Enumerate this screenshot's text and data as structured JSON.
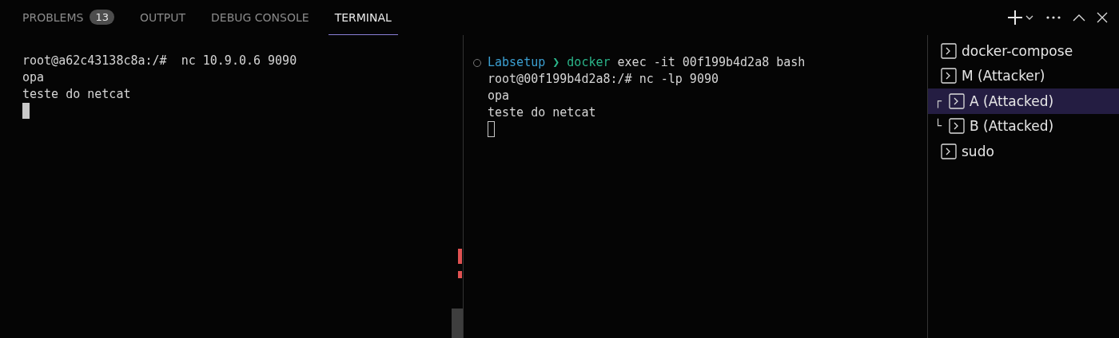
{
  "tabs": [
    {
      "label": "PROBLEMS",
      "badge": "13",
      "selected": false
    },
    {
      "label": "OUTPUT",
      "selected": false
    },
    {
      "label": "DEBUG CONSOLE",
      "selected": false
    },
    {
      "label": "TERMINAL",
      "selected": true
    }
  ],
  "terminals": [
    {
      "lines": [
        "root@a62c43138c8a:/#  nc 10.9.0.6 9090",
        "opa",
        "teste do netcat"
      ],
      "cursor_focused": true
    },
    {
      "prompt": [
        {
          "text": "Labsetup",
          "color": "#3b9fd1"
        },
        {
          "text": " ❯ ",
          "color": "#2bb58a"
        },
        {
          "text": "docker",
          "color": "#2bb58a"
        },
        {
          "text": " exec -it 00f199b4d2a8 bash",
          "color": "#d4d4d4"
        }
      ],
      "lines": [
        "root@00f199b4d2a8:/# nc -lp 9090",
        "opa",
        "teste do netcat"
      ],
      "cursor_focused": false
    }
  ],
  "terminal_list": [
    {
      "label": "docker-compose",
      "selected": false
    },
    {
      "label": "M (Attacker)",
      "selected": false
    },
    {
      "label": "A (Attacked)",
      "marker": "┌",
      "selected": true
    },
    {
      "label": "B (Attacked)",
      "marker": "└",
      "selected": false
    },
    {
      "label": "sudo",
      "selected": false
    }
  ]
}
